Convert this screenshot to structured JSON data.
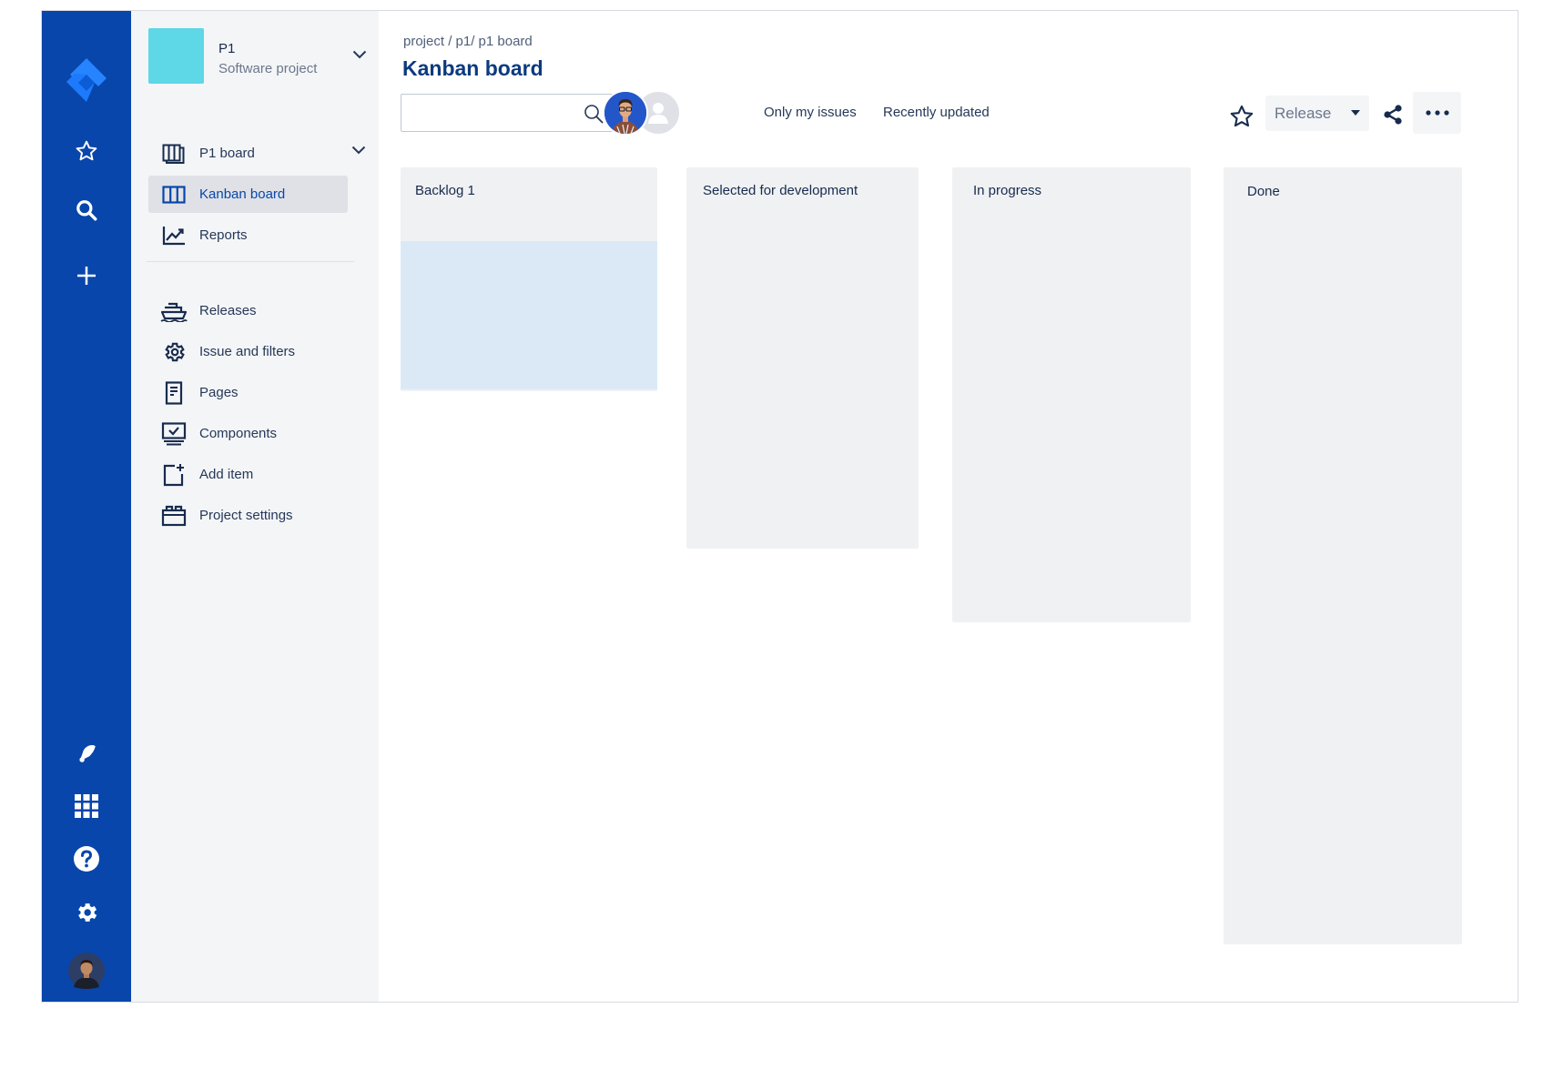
{
  "colors": {
    "rail": "#0846ab",
    "sidebar": "#f4f5f7",
    "project_avatar": "#5ed7e6",
    "accent": "#0846ab",
    "column": "#f0f1f3",
    "drop_zone": "#dbe9f7"
  },
  "rail": {
    "top_icons": [
      "jira-logo-icon",
      "star-icon",
      "search-icon",
      "plus-icon"
    ],
    "bottom_icons": [
      "notifications-icon",
      "app-switcher-icon",
      "help-icon",
      "settings-icon",
      "profile-avatar"
    ]
  },
  "project": {
    "name": "P1",
    "type": "Software project"
  },
  "sidebar": {
    "board_group": "P1 board",
    "items": [
      {
        "label": "Kanban board",
        "icon": "columns-icon",
        "active": true
      },
      {
        "label": "Reports",
        "icon": "chart-line-icon"
      },
      {
        "label": "Releases",
        "icon": "ship-icon"
      },
      {
        "label": "Issue and filters",
        "icon": "gear-icon"
      },
      {
        "label": "Pages",
        "icon": "document-icon"
      },
      {
        "label": "Components",
        "icon": "monitor-check-icon"
      },
      {
        "label": "Add item",
        "icon": "add-item-icon"
      },
      {
        "label": "Project settings",
        "icon": "briefcase-icon"
      }
    ]
  },
  "header": {
    "breadcrumb": "project / p1/ p1 board",
    "title": "Kanban board"
  },
  "toolbar": {
    "search_value": "",
    "filters": [
      "Only my issues",
      "Recently updated"
    ],
    "release_label": "Release"
  },
  "board": {
    "columns": [
      {
        "title": "Backlog 1"
      },
      {
        "title": "Selected for development"
      },
      {
        "title": "In progress"
      },
      {
        "title": "Done"
      }
    ]
  }
}
